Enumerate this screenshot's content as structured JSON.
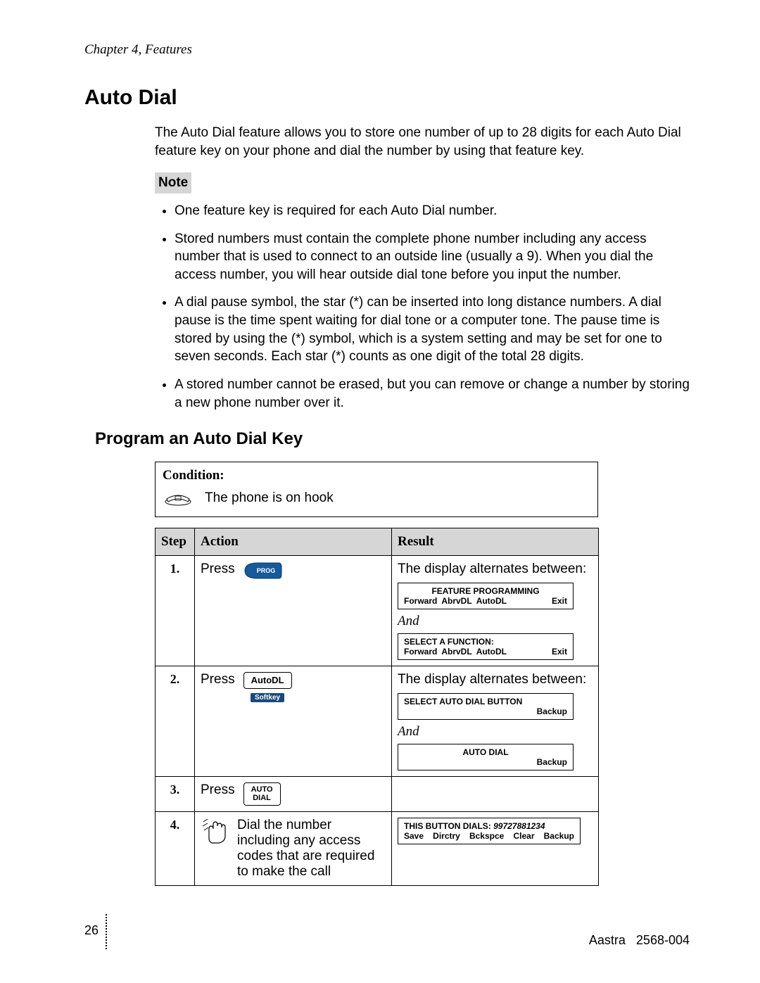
{
  "header": {
    "running": "Chapter 4, Features"
  },
  "section": {
    "title": "Auto Dial",
    "intro": "The Auto Dial feature allows you to store one number of up to 28 digits for each Auto Dial feature key on your phone and dial the number by using that feature key.",
    "note_label": "Note",
    "notes": [
      "One feature key is required for each Auto Dial number.",
      "Stored numbers must contain the complete phone number including any access number that is used to connect to an outside line (usually a 9).  When you dial the access number, you will hear outside dial tone before you input the number.",
      "A dial pause symbol, the star (*) can be inserted into long distance numbers.  A dial pause is the time spent waiting for dial tone or a computer tone.  The pause time is stored by using the (*) symbol, which is a system setting and may be set for one to seven seconds.  Each star (*) counts as one digit of the total 28 digits.",
      "A stored number cannot be erased, but you can remove or change a number by storing a new phone number over it."
    ],
    "subtitle": "Program an Auto Dial Key"
  },
  "condition": {
    "label": "Condition:",
    "text": "The phone is on hook"
  },
  "table": {
    "headers": {
      "step": "Step",
      "action": "Action",
      "result": "Result"
    },
    "press": "Press",
    "and": "And",
    "step1": {
      "num": "1.",
      "key_label": "PROG",
      "result_intro": "The display alternates between:",
      "lcd1": {
        "title": "FEATURE PROGRAMMING",
        "row": [
          "Forward",
          "AbrvDL",
          "AutoDL",
          "Exit"
        ]
      },
      "lcd2": {
        "title": "SELECT A FUNCTION:",
        "row": [
          "Forward",
          "AbrvDL",
          "AutoDL",
          "Exit"
        ]
      }
    },
    "step2": {
      "num": "2.",
      "key_label": "AutoDL",
      "softkey": "Softkey",
      "result_intro": "The display alternates between:",
      "lcd1": {
        "title": "SELECT AUTO DIAL BUTTON",
        "row_right": "Backup"
      },
      "lcd2": {
        "title": "AUTO DIAL",
        "row_right": "Backup"
      }
    },
    "step3": {
      "num": "3.",
      "key_line1": "AUTO",
      "key_line2": "DIAL"
    },
    "step4": {
      "num": "4.",
      "action_text": "Dial the number including any access codes that are required to make the call",
      "lcd": {
        "line1a": "THIS BUTTON DIALS: ",
        "line1b": "99727881234",
        "row": [
          "Save",
          "Dirctry",
          "Bckspce",
          "Clear",
          "Backup"
        ]
      }
    }
  },
  "footer": {
    "page": "26",
    "brand": "Aastra",
    "doc": "2568-004"
  }
}
